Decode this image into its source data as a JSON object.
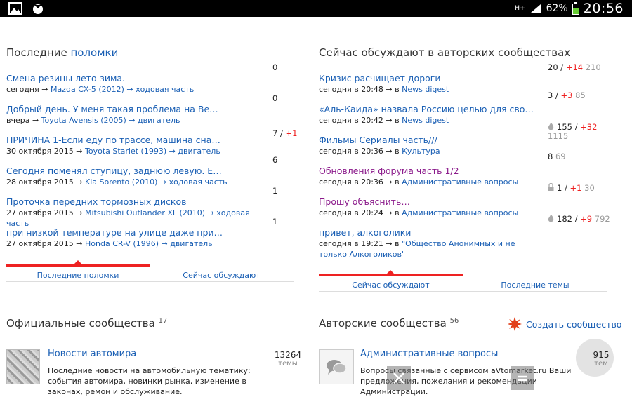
{
  "status": {
    "battery": "62%",
    "time": "20:56",
    "net": "H+"
  },
  "left": {
    "title_plain": "Последние ",
    "title_link": "поломки",
    "items": [
      {
        "title": "Смена резины лето-зима.",
        "date": "сегодня",
        "car": "Mazda CX-5 (2012)",
        "cat": "ходовая часть",
        "count": "0"
      },
      {
        "title": "Добрый день. У меня такая проблема на Ве…",
        "date": "вчера",
        "car": "Toyota Avensis (2005)",
        "cat": "двигатель",
        "count": "0"
      },
      {
        "title": "ПРИЧИНА 1-Если еду по трассе, машина сна…",
        "date": "30 октября 2015",
        "car": "Toyota Starlet (1993)",
        "cat": "двигатель",
        "count": "7 /",
        "count_new": "+1"
      },
      {
        "title": "Сегодня поменял ступицу, заднюю левую. Е…",
        "date": "28 октября 2015",
        "car": "Kia Sorento (2010)",
        "cat": "ходовая часть",
        "count": "6"
      },
      {
        "title": "Проточка передних тормозных дисков",
        "date": "27 октября 2015",
        "car": "Mitsubishi Outlander XL (2010)",
        "cat": "ходовая часть",
        "count": "1"
      },
      {
        "title": "при низкой температуре на улице даже при…",
        "date": "27 октября 2015",
        "car": "Honda CR-V (1996)",
        "cat": "двигатель",
        "count": "1"
      }
    ],
    "tabs": [
      "Последние поломки",
      "Сейчас обсуждают"
    ]
  },
  "right": {
    "title": "Сейчас обсуждают в авторских сообществах",
    "items": [
      {
        "title": "Кризис расчищает дороги",
        "date": "сегодня в 20:48",
        "cat": "News digest",
        "c1": "20 /",
        "c2": "+14",
        "c3": "210",
        "purple": false
      },
      {
        "title": "«Аль-Каида» назвала Россию целью для своих…",
        "date": "сегодня в 20:42",
        "cat": "News digest",
        "c1": "3 /",
        "c2": "+3",
        "c3": "85",
        "purple": false
      },
      {
        "title": "Фильмы Сериалы часть///",
        "date": "сегодня в 20:36",
        "cat": "Культура",
        "c1": "155 /",
        "c2": "+32",
        "c3": "1115",
        "purple": false
      },
      {
        "title": "Обновления форума часть 1/2",
        "date": "сегодня в 20:36",
        "cat": "Административные вопросы",
        "c1": "8",
        "c2": "",
        "c3": "69",
        "purple": true
      },
      {
        "title": "Прошу объяснить…",
        "date": "сегодня в 20:24",
        "cat": "Административные вопросы",
        "c1": "1 /",
        "c2": "+1",
        "c3": "30",
        "purple": true
      },
      {
        "title": "привет, алкоголики",
        "date": "сегодня в 19:21",
        "cat": "\"Общество Анонимных и не только Алкоголиков\"",
        "c1": "182 /",
        "c2": "+9",
        "c3": "792",
        "purple": false
      }
    ],
    "tabs": [
      "Сейчас обсуждают",
      "Последние темы"
    ]
  },
  "official": {
    "title": "Официальные сообщества",
    "count": "17",
    "name": "Новости автомира",
    "desc": "Последние новости на автомобильную тематику: события автомира, новинки рынка, изменение в законах, ремон и обслуживание.",
    "num": "13264",
    "num_label": "темы"
  },
  "author": {
    "title": "Авторские сообщества",
    "count": "56",
    "create": "Создать сообщество",
    "name": "Административные вопросы",
    "desc": "Вопросы связанные с сервисом aVtomarket.ru Ваши предложения, пожелания и рекомендации Администрации.",
    "num": "915",
    "num_label": "тем"
  },
  "arrow": "→"
}
